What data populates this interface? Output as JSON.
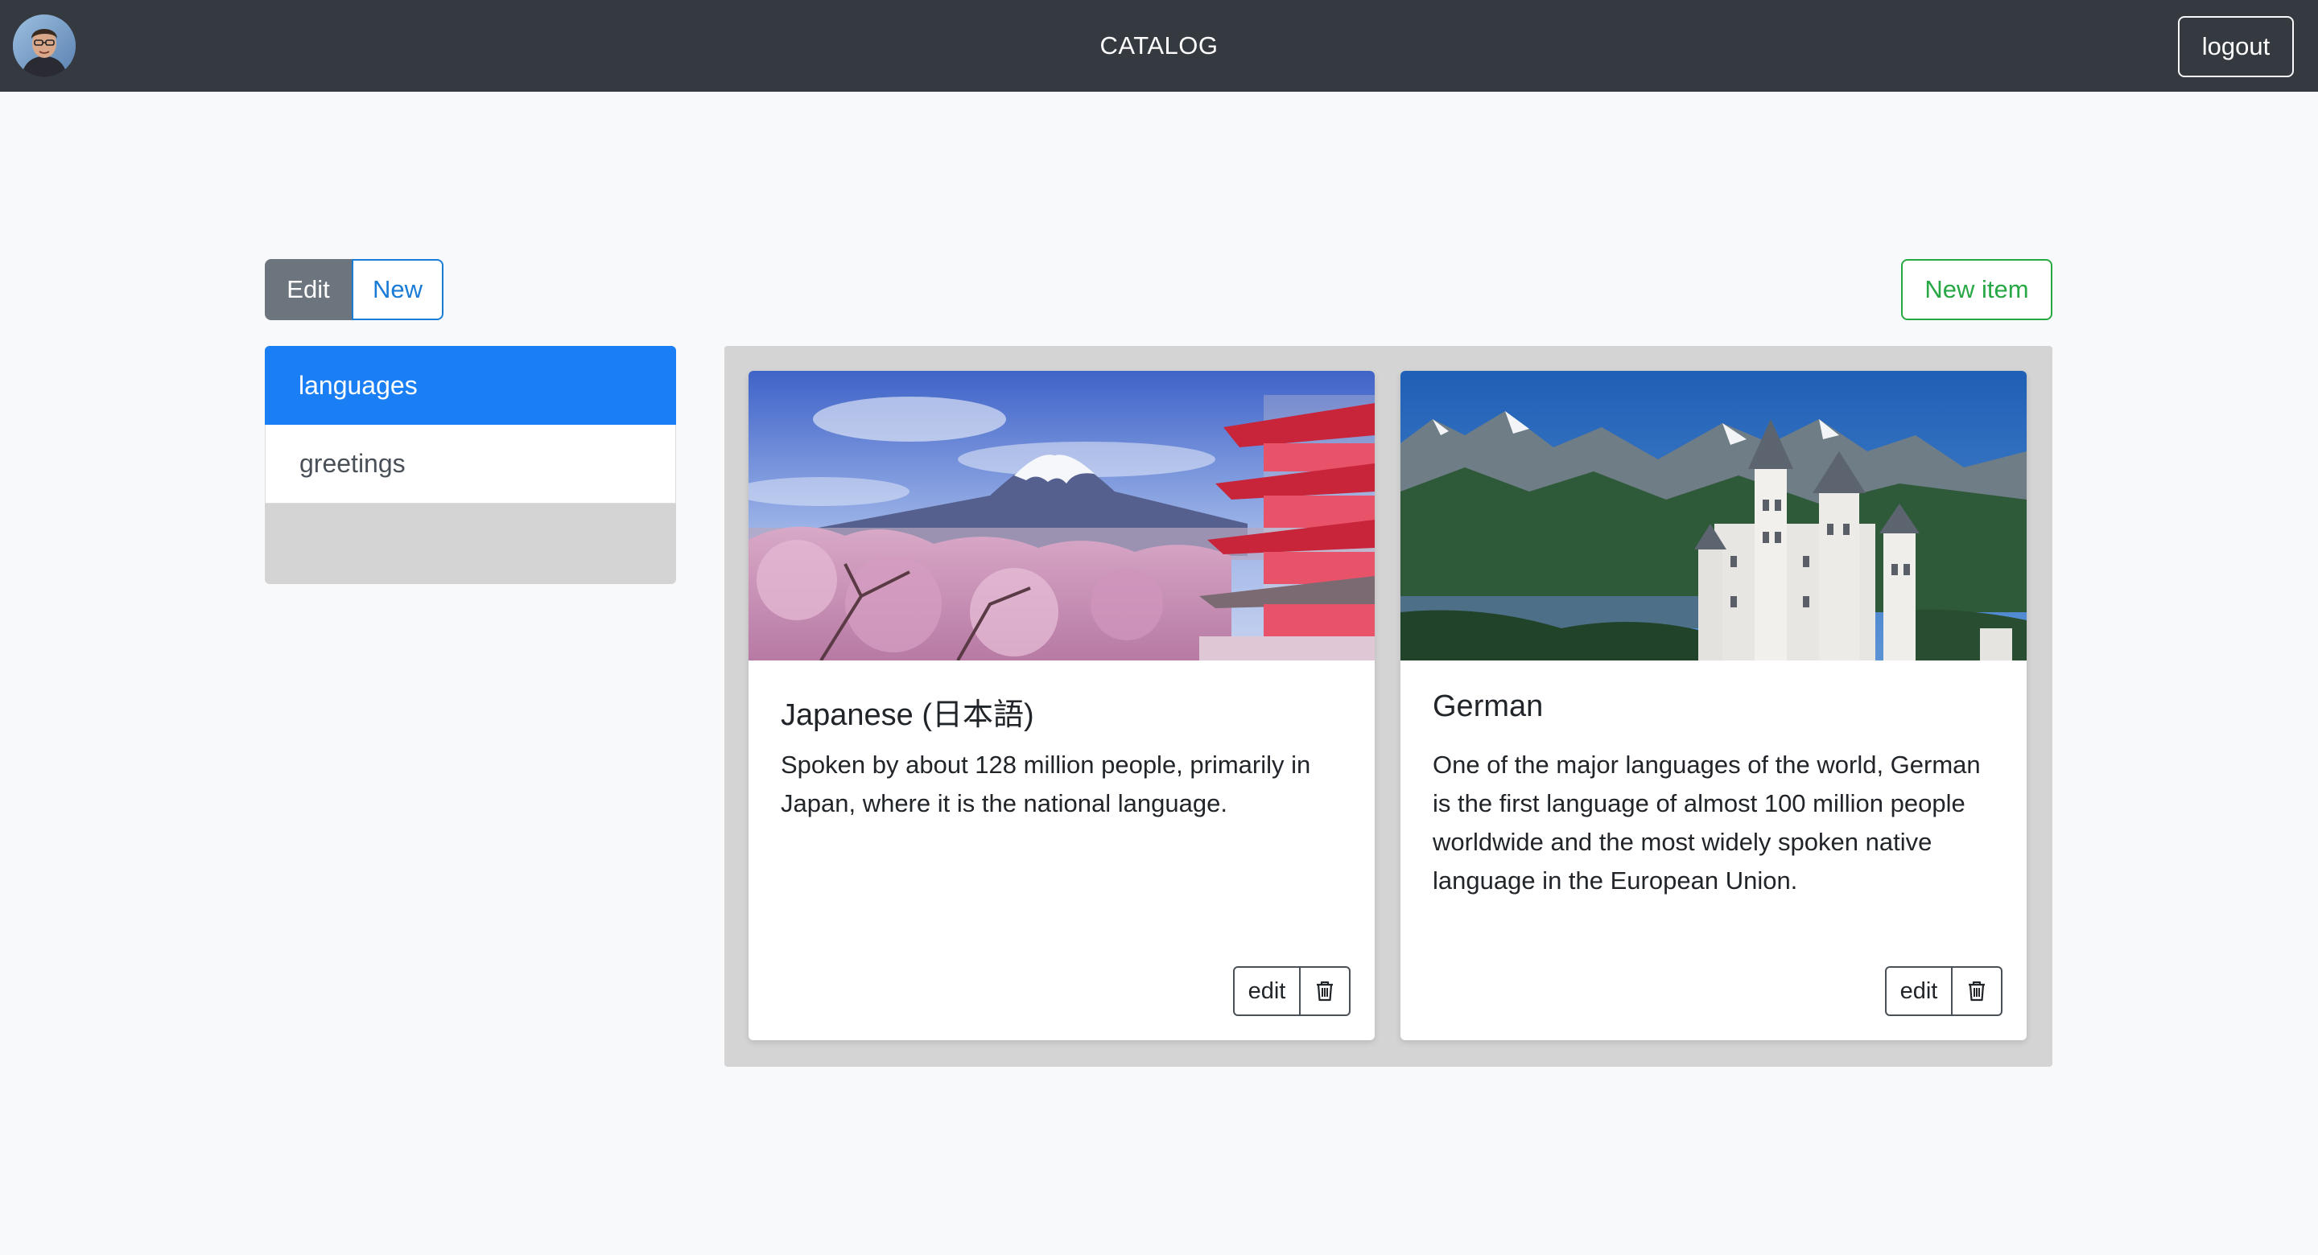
{
  "navbar": {
    "brand": "CATALOG",
    "logout_label": "logout",
    "avatar": "user-avatar"
  },
  "toolbar": {
    "edit_label": "Edit",
    "new_label": "New",
    "new_item_label": "New item"
  },
  "sidebar": {
    "items": [
      {
        "label": "languages",
        "active": true
      },
      {
        "label": "greetings",
        "active": false
      }
    ]
  },
  "cards": [
    {
      "title": "Japanese (日本語)",
      "text": "Spoken by about 128 million people, primarily in Japan, where it is the national language.",
      "image": "mount-fuji-pagoda-cherry-blossoms",
      "edit_label": "edit",
      "delete_icon": "trash-icon"
    },
    {
      "title": "German",
      "text": "One of the major languages of the world, German is the first language of almost 100 million people worldwide and the most widely spoken native language in the European Union.",
      "image": "neuschwanstein-castle-mountains",
      "edit_label": "edit",
      "delete_icon": "trash-icon"
    }
  ],
  "colors": {
    "navbar_bg": "#343a40",
    "primary": "#1a7ff5",
    "success": "#28a745",
    "secondary": "#6c757d",
    "panel_bg": "#d4d4d4",
    "page_bg": "#f8f9fa"
  }
}
